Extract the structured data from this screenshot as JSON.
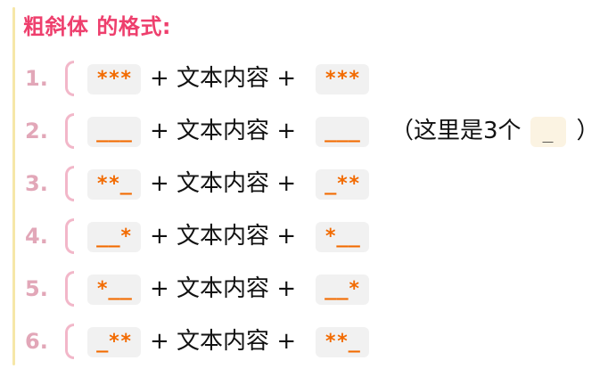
{
  "title": "粗斜体 的格式:",
  "rows": [
    {
      "num": "1.",
      "left": "***",
      "middle": "+ 文本内容 +",
      "right": "***"
    },
    {
      "num": "2.",
      "left": "___",
      "middle": "+ 文本内容 +",
      "right": "___",
      "note_prefix": "（这里是3个",
      "note_chip": "_",
      "note_suffix": "）"
    },
    {
      "num": "3.",
      "left": "**_",
      "middle": "+ 文本内容 +",
      "right": "_**"
    },
    {
      "num": "4.",
      "left": "__*",
      "middle": "+ 文本内容 +",
      "right": "*__"
    },
    {
      "num": "5.",
      "left": "*__",
      "middle": "+ 文本内容 +",
      "right": "__*"
    },
    {
      "num": "6.",
      "left": "_**",
      "middle": "+ 文本内容 +",
      "right": "**_"
    }
  ],
  "colors": {
    "title": "#ee3f6d",
    "numbers": "#e2a7b8",
    "chip_text": "#f26a00",
    "chip_bg": "#f1f1f1",
    "left_rule": "#f6e7a8"
  }
}
